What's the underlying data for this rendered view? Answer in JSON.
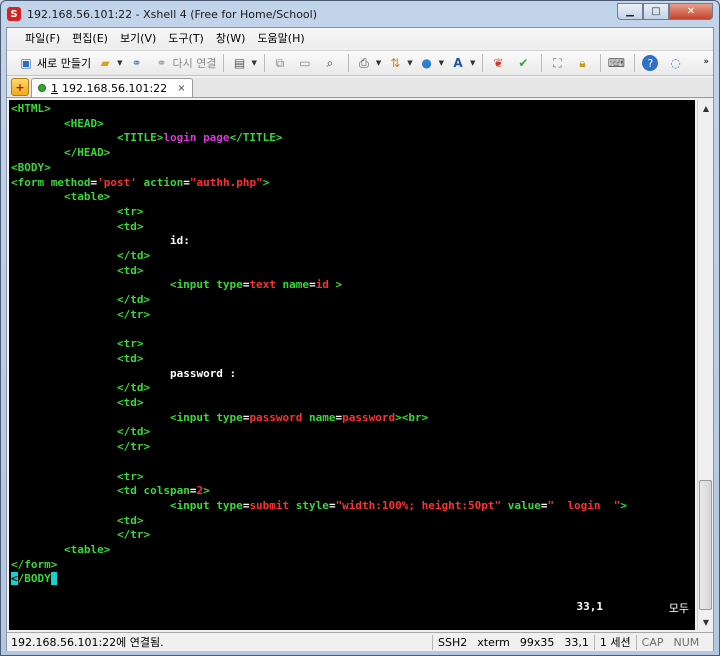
{
  "window": {
    "title": "192.168.56.101:22 - Xshell 4 (Free for Home/School)",
    "app_icon": "S"
  },
  "menubar": {
    "items": [
      {
        "label": "파일(F)"
      },
      {
        "label": "편집(E)"
      },
      {
        "label": "보기(V)"
      },
      {
        "label": "도구(T)"
      },
      {
        "label": "창(W)"
      },
      {
        "label": "도움말(H)"
      }
    ]
  },
  "toolbar": {
    "new_label": "새로 만들기",
    "reconnect_label": "다시 연결"
  },
  "tabs": [
    {
      "number": "1",
      "label": "192.168.56.101:22",
      "close": "×"
    }
  ],
  "terminal": {
    "lines": [
      [
        {
          "t": "<HTML>",
          "c": "c-tag"
        }
      ],
      [
        {
          "t": "        <HEAD>",
          "c": "c-tag"
        }
      ],
      [
        {
          "t": "                <TITLE>",
          "c": "c-tag"
        },
        {
          "t": "login page",
          "c": "c-attr"
        },
        {
          "t": "</TITLE>",
          "c": "c-tag"
        }
      ],
      [
        {
          "t": "        </HEAD>",
          "c": "c-tag"
        }
      ],
      [
        {
          "t": "<BODY>",
          "c": "c-tag"
        }
      ],
      [
        {
          "t": "<form ",
          "c": "c-tag"
        },
        {
          "t": "method",
          "c": "c-tag"
        },
        {
          "t": "=",
          "c": "c-text"
        },
        {
          "t": "'post'",
          "c": "c-val"
        },
        {
          "t": " action",
          "c": "c-tag"
        },
        {
          "t": "=",
          "c": "c-text"
        },
        {
          "t": "\"authh.php\"",
          "c": "c-val"
        },
        {
          "t": ">",
          "c": "c-tag"
        }
      ],
      [
        {
          "t": "        <table>",
          "c": "c-tag"
        }
      ],
      [
        {
          "t": "                <tr>",
          "c": "c-tag"
        }
      ],
      [
        {
          "t": "                <td>",
          "c": "c-tag"
        }
      ],
      [
        {
          "t": "                        ",
          "c": "c-text"
        },
        {
          "t": "id:",
          "c": "c-text"
        }
      ],
      [
        {
          "t": "                </td>",
          "c": "c-tag"
        }
      ],
      [
        {
          "t": "                <td>",
          "c": "c-tag"
        }
      ],
      [
        {
          "t": "                        <input ",
          "c": "c-tag"
        },
        {
          "t": "type",
          "c": "c-tag"
        },
        {
          "t": "=",
          "c": "c-text"
        },
        {
          "t": "text",
          "c": "c-val"
        },
        {
          "t": " name",
          "c": "c-tag"
        },
        {
          "t": "=",
          "c": "c-text"
        },
        {
          "t": "id",
          "c": "c-val"
        },
        {
          "t": " >",
          "c": "c-tag"
        }
      ],
      [
        {
          "t": "                </td>",
          "c": "c-tag"
        }
      ],
      [
        {
          "t": "                </tr>",
          "c": "c-tag"
        }
      ],
      [
        {
          "t": "",
          "c": "c-text"
        }
      ],
      [
        {
          "t": "                <tr>",
          "c": "c-tag"
        }
      ],
      [
        {
          "t": "                <td>",
          "c": "c-tag"
        }
      ],
      [
        {
          "t": "                        ",
          "c": "c-text"
        },
        {
          "t": "password :",
          "c": "c-text"
        }
      ],
      [
        {
          "t": "                </td>",
          "c": "c-tag"
        }
      ],
      [
        {
          "t": "                <td>",
          "c": "c-tag"
        }
      ],
      [
        {
          "t": "                        <input ",
          "c": "c-tag"
        },
        {
          "t": "type",
          "c": "c-tag"
        },
        {
          "t": "=",
          "c": "c-text"
        },
        {
          "t": "password",
          "c": "c-val"
        },
        {
          "t": " name",
          "c": "c-tag"
        },
        {
          "t": "=",
          "c": "c-text"
        },
        {
          "t": "password",
          "c": "c-val"
        },
        {
          "t": "><br>",
          "c": "c-tag"
        }
      ],
      [
        {
          "t": "                </td>",
          "c": "c-tag"
        }
      ],
      [
        {
          "t": "                </tr>",
          "c": "c-tag"
        }
      ],
      [
        {
          "t": "",
          "c": "c-text"
        }
      ],
      [
        {
          "t": "                <tr>",
          "c": "c-tag"
        }
      ],
      [
        {
          "t": "                <td ",
          "c": "c-tag"
        },
        {
          "t": "colspan",
          "c": "c-tag"
        },
        {
          "t": "=",
          "c": "c-text"
        },
        {
          "t": "2",
          "c": "c-val"
        },
        {
          "t": ">",
          "c": "c-tag"
        }
      ],
      [
        {
          "t": "                        <input ",
          "c": "c-tag"
        },
        {
          "t": "type",
          "c": "c-tag"
        },
        {
          "t": "=",
          "c": "c-text"
        },
        {
          "t": "submit",
          "c": "c-val"
        },
        {
          "t": " style",
          "c": "c-tag"
        },
        {
          "t": "=",
          "c": "c-text"
        },
        {
          "t": "\"width:100%; height:50pt\"",
          "c": "c-val"
        },
        {
          "t": " value",
          "c": "c-tag"
        },
        {
          "t": "=",
          "c": "c-text"
        },
        {
          "t": "\"  login  \"",
          "c": "c-val"
        },
        {
          "t": ">",
          "c": "c-tag"
        }
      ],
      [
        {
          "t": "                <td>",
          "c": "c-tag"
        }
      ],
      [
        {
          "t": "                </tr>",
          "c": "c-tag"
        }
      ],
      [
        {
          "t": "        <table>",
          "c": "c-tag"
        }
      ],
      [
        {
          "t": "</form>",
          "c": "c-tag"
        }
      ],
      [
        {
          "t": "<",
          "c": "c-cursor"
        },
        {
          "t": "/BODY",
          "c": "c-tag"
        },
        {
          "t": " ",
          "c": "c-cursor"
        }
      ]
    ],
    "cursor_position": "33,1",
    "mode": "모두"
  },
  "statusbar": {
    "connection": "192.168.56.101:22에 연결됨.",
    "protocol": "SSH2",
    "terminal_type": "xterm",
    "size": "99x35",
    "cursor": "33,1",
    "sessions": "1 세션",
    "cap": "CAP",
    "num": "NUM"
  }
}
